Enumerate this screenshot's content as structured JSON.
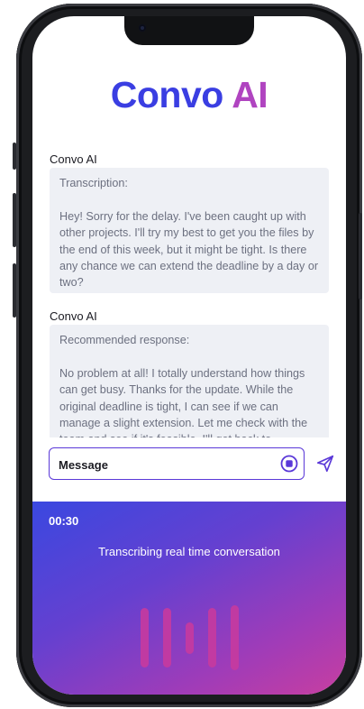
{
  "app": {
    "title_part1": "Convo",
    "title_part2": "AI"
  },
  "messages": [
    {
      "sender": "Convo AI",
      "heading": "Transcription:",
      "body": "Hey! Sorry for the delay. I've been caught up with other projects. I'll try my best to get you the files by the end of this week, but it might be tight. Is there any chance we can extend the deadline by a day or two?"
    },
    {
      "sender": "Convo AI",
      "heading": "Recommended response:",
      "body": "No problem at all! I totally understand how things can get busy. Thanks for the update. While the original deadline is tight, I can see if we can manage a slight extension. Let me check with the team and see if it's feasible. I'll get back to"
    }
  ],
  "composer": {
    "placeholder": "Message",
    "stop_icon": "stop-circle-icon",
    "send_icon": "send-icon"
  },
  "recording": {
    "timer": "00:30",
    "status": "Transcribing real time conversation",
    "waveform_levels": [
      0.85,
      0.85,
      0.45,
      0.85,
      0.92
    ]
  },
  "colors": {
    "title_start": "#3a3ee2",
    "title_end": "#b044c0",
    "accent": "#5a38d8",
    "bubble_bg": "#eef0f5",
    "panel_gradient_start": "#3a48e0",
    "panel_gradient_end": "#c83ea0",
    "wave_bar": "#c63a9e"
  }
}
